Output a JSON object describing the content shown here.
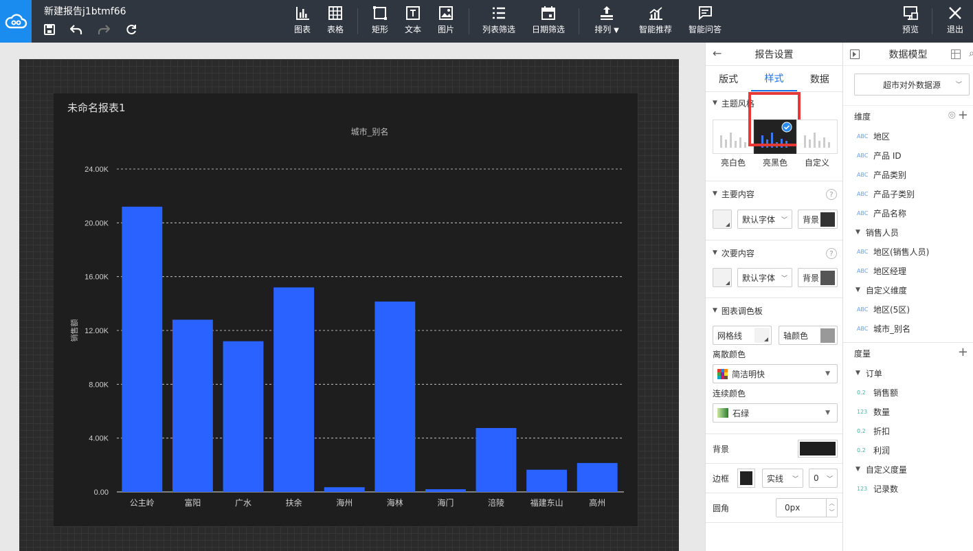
{
  "topbar": {
    "title": "新建报告j1btmf66",
    "tools": [
      {
        "label": "图表",
        "icon": "bar-chart-icon"
      },
      {
        "label": "表格",
        "icon": "table-icon"
      },
      {
        "label": "矩形",
        "icon": "rectangle-icon"
      },
      {
        "label": "文本",
        "icon": "text-icon"
      },
      {
        "label": "图片",
        "icon": "image-icon"
      },
      {
        "label": "列表筛选",
        "icon": "list-filter-icon"
      },
      {
        "label": "日期筛选",
        "icon": "calendar-icon"
      },
      {
        "label": "排列",
        "icon": "arrange-icon"
      },
      {
        "label": "智能推荐",
        "icon": "smart-recommend-icon"
      },
      {
        "label": "智能问答",
        "icon": "smart-qa-icon"
      }
    ],
    "preview_label": "预览",
    "exit_label": "退出"
  },
  "report": {
    "title": "未命名报表1"
  },
  "chart_data": {
    "type": "bar",
    "title": "城市_别名",
    "ylabel": "销售额",
    "xlabel": "",
    "categories": [
      "公主岭",
      "富阳",
      "广水",
      "扶余",
      "海州",
      "海林",
      "海门",
      "涪陵",
      "福建东山",
      "高州"
    ],
    "values": [
      21200,
      12800,
      11200,
      15200,
      350,
      14150,
      200,
      4750,
      1650,
      2150
    ],
    "ylim": [
      0,
      24000
    ],
    "yticks": [
      "0.00",
      "4.00K",
      "8.00K",
      "12.00K",
      "16.00K",
      "20.00K",
      "24.00K"
    ],
    "bar_color": "#2962ff",
    "grid": true
  },
  "settings": {
    "header": "报告设置",
    "tabs": [
      "版式",
      "样式",
      "数据"
    ],
    "theme": {
      "title": "主题风格",
      "options": [
        "亮白色",
        "亮黑色",
        "自定义"
      ],
      "selected": "亮黑色"
    },
    "main_content": {
      "title": "主要内容",
      "font": "默认字体",
      "bg_label": "背景",
      "bg_color": "#333333"
    },
    "secondary_content": {
      "title": "次要内容",
      "font": "默认字体",
      "bg_label": "背景",
      "bg_color": "#555555"
    },
    "palette": {
      "title": "图表调色板",
      "grid_label": "网格线",
      "axis_label": "轴颜色",
      "discrete_label": "离散颜色",
      "discrete_value": "简洁明快",
      "continuous_label": "连续颜色",
      "continuous_value": "石绿"
    },
    "background": {
      "label": "背景",
      "color": "#1e1e1e"
    },
    "border": {
      "label": "边框",
      "style": "实线",
      "width": "0",
      "color": "#222222"
    },
    "radius": {
      "label": "圆角",
      "value": "0px"
    }
  },
  "datamodel": {
    "header": "数据模型",
    "source": "超市对外数据源",
    "dimensions_label": "维度",
    "dimensions": [
      {
        "type": "ABC",
        "name": "地区",
        "indent": 0
      },
      {
        "type": "ABC",
        "name": "产品 ID",
        "indent": 0
      },
      {
        "type": "ABC",
        "name": "产品类别",
        "indent": 0
      },
      {
        "type": "ABC",
        "name": "产品子类别",
        "indent": 0
      },
      {
        "type": "ABC",
        "name": "产品名称",
        "indent": 0
      },
      {
        "group": "销售人员"
      },
      {
        "type": "ABC",
        "name": "地区(销售人员)",
        "indent": 1
      },
      {
        "type": "ABC",
        "name": "地区经理",
        "indent": 1
      },
      {
        "group": "自定义维度"
      },
      {
        "type": "ABC",
        "name": "地区(5区)",
        "indent": 1
      },
      {
        "type": "ABC",
        "name": "城市_别名",
        "indent": 1
      }
    ],
    "measures_label": "度量",
    "measures": [
      {
        "group": "订单"
      },
      {
        "type": "0.2",
        "name": "销售额",
        "indent": 1
      },
      {
        "type": "123",
        "name": "数量",
        "indent": 1
      },
      {
        "type": "0.2",
        "name": "折扣",
        "indent": 1
      },
      {
        "type": "0.2",
        "name": "利润",
        "indent": 1
      },
      {
        "group": "自定义度量"
      },
      {
        "type": "123",
        "name": "记录数",
        "indent": 1
      }
    ]
  }
}
